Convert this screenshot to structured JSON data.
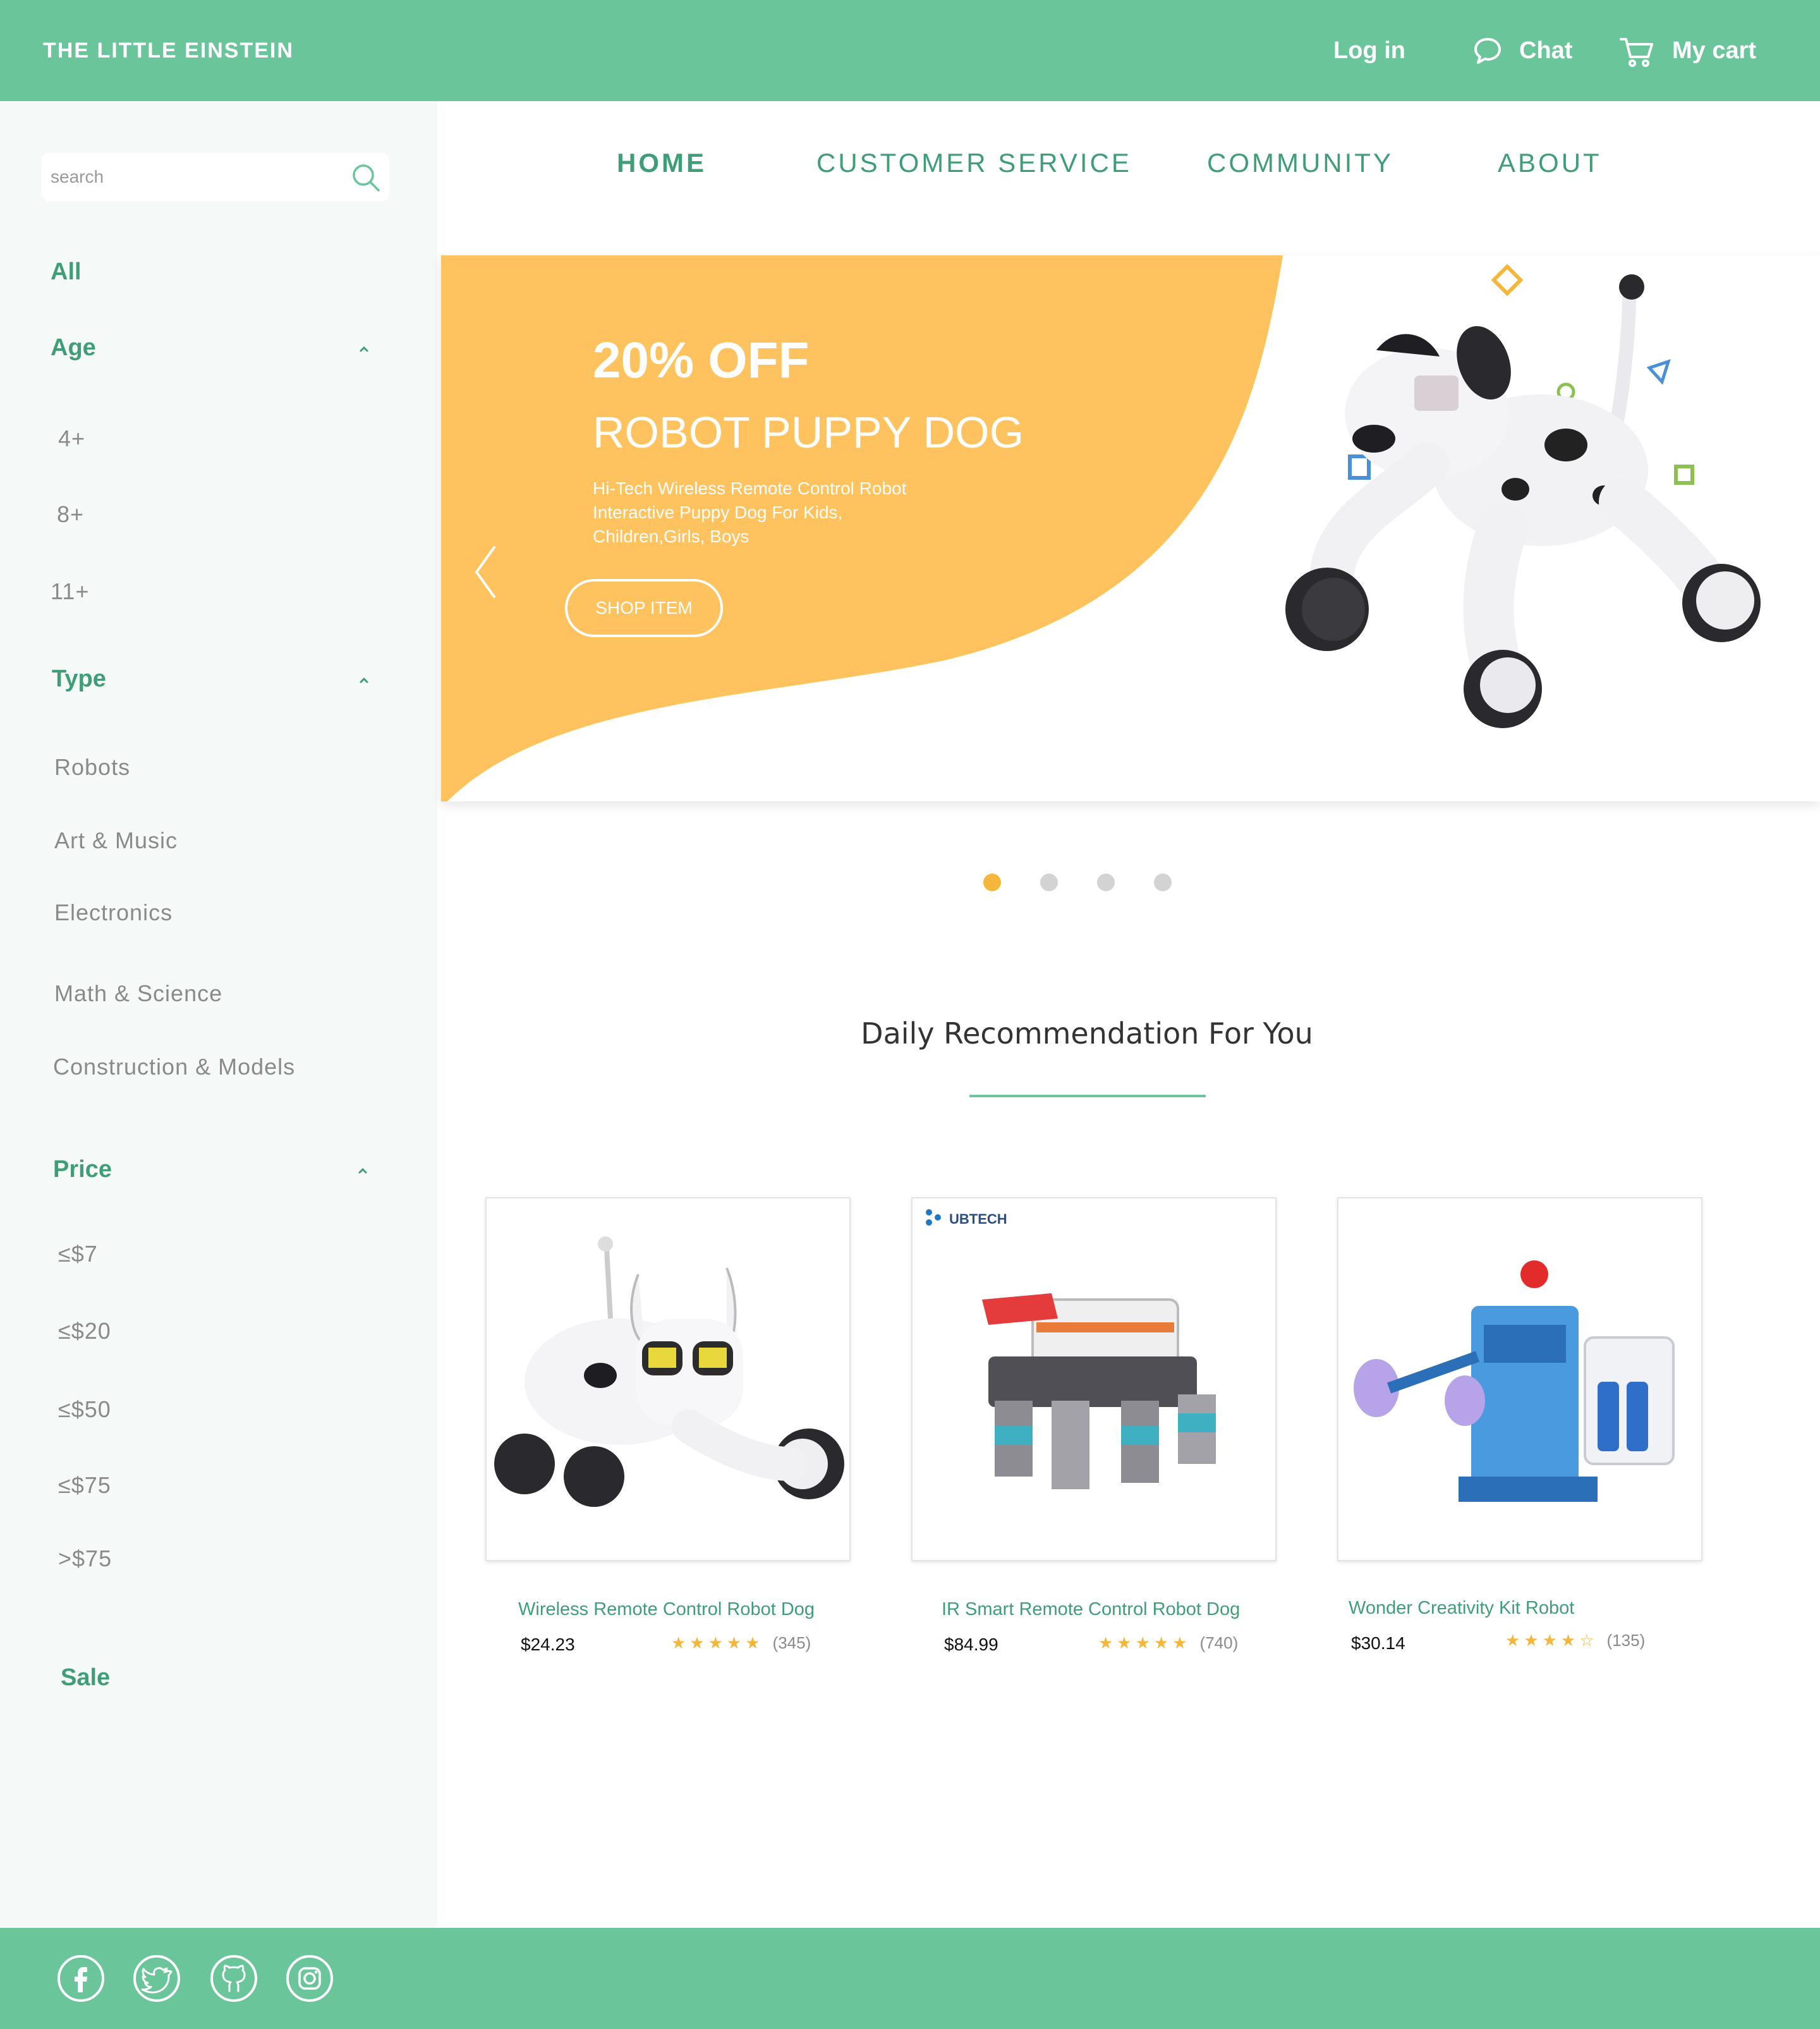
{
  "header": {
    "brand": "THE LITTLE EINSTEIN",
    "login_label": "Log in",
    "chat_label": "Chat",
    "cart_label": "My cart",
    "chat_icon": "chat-bubble-icon",
    "cart_icon": "shopping-cart-icon"
  },
  "search": {
    "placeholder": "search",
    "value": "",
    "icon": "search-icon"
  },
  "sidebar": {
    "all_label": "All",
    "age": {
      "label": "Age",
      "items": [
        "4+",
        "8+",
        "11+"
      ]
    },
    "type": {
      "label": "Type",
      "items": [
        "Robots",
        "Art & Music",
        "Electronics",
        "Math & Science",
        "Construction & Models"
      ]
    },
    "price": {
      "label": "Price",
      "items": [
        "≤$7",
        "≤$20",
        "≤$50",
        "≤$75",
        ">$75"
      ]
    },
    "sale_label": "Sale"
  },
  "nav": {
    "items": [
      "HOME",
      "CUSTOMER SERVICE",
      "COMMUNITY",
      "ABOUT"
    ],
    "active": "HOME"
  },
  "hero": {
    "discount": "20% OFF",
    "title": "ROBOT PUPPY DOG",
    "description": "Hi-Tech Wireless Remote Control Robot Interactive Puppy Dog For Kids, Children,Girls, Boys",
    "button_label": "SHOP ITEM",
    "slide_count": 4,
    "active_slide": 1
  },
  "recommendation": {
    "title": "Daily Recommendation For You",
    "products": [
      {
        "name": "Wireless Remote Control Robot Dog",
        "price": "$24.23",
        "rating": 5,
        "reviews": "(345)"
      },
      {
        "name": "IR Smart Remote Control Robot Dog",
        "price": "$84.99",
        "rating": 5,
        "reviews": "(740)",
        "brand_logo": "UBTECH"
      },
      {
        "name": "Wonder Creativity Kit Robot",
        "price": "$30.14",
        "rating": 4.5,
        "reviews": "(135)"
      }
    ]
  },
  "footer": {
    "social": [
      "facebook-icon",
      "twitter-icon",
      "github-icon",
      "instagram-icon"
    ]
  },
  "colors": {
    "brand_green": "#6ac69a",
    "text_green": "#3f9e78",
    "accent_yellow": "#fec35e",
    "dot_yellow": "#f4b73c"
  }
}
